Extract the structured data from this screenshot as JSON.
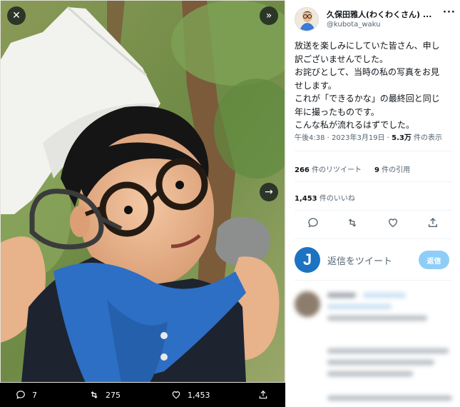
{
  "viewer": {
    "close_icon": "close-icon",
    "expand_icon": "chevron-double-right-icon",
    "next_icon": "arrow-right-icon",
    "bar": {
      "reply_count": "7",
      "retweet_count": "275",
      "like_count": "1,453"
    }
  },
  "tweet": {
    "author_name": "久保田雅人(わくわくさん) ...",
    "author_handle": "@kubota_waku",
    "more_icon": "···",
    "text_lines": [
      "放送を楽しみにしていた皆さん、申し",
      "訳ございませんでした。",
      "お詫びとして、当時の私の写真をお見",
      "せします。",
      "これが「できるかな」の最終回と同じ",
      "年に撮ったものです。",
      "こんな私が流れるはずでした。"
    ],
    "time": "午後4:38",
    "date": "2023年3月19日",
    "views_count": "5.3万",
    "views_label": "件の表示",
    "retweets_count": "266",
    "retweets_label": "件のリツイート",
    "quotes_count": "9",
    "quotes_label": "件の引用",
    "likes_count": "1,453",
    "likes_label": "件のいいね"
  },
  "reply": {
    "avatar_letter": "J",
    "placeholder": "返信をツイート",
    "button_label": "返信"
  },
  "colors": {
    "accent": "#1d9bf0",
    "reply_button": "#8ecdf8",
    "text_primary": "#0f1419",
    "text_secondary": "#536471"
  }
}
